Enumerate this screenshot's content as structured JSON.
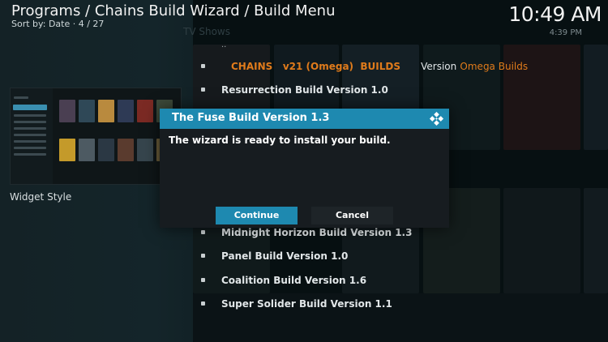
{
  "header": {
    "breadcrumb": "Programs / Chains Build Wizard / Build Menu",
    "sort_info": "Sort by: Date  ·  4 / 27",
    "clock": "10:49 AM",
    "clock_sub": "4:39 PM"
  },
  "background": {
    "faint_label": "TV Shows"
  },
  "widget": {
    "label": "Widget Style"
  },
  "menu": {
    "parent": "..",
    "top_row": {
      "chains": "CHAINS",
      "kodi_version": "v21 (Omega)",
      "builds": "BUILDS",
      "version_label": "Version",
      "version_value": "Omega Builds"
    },
    "items": [
      "Resurrection Build Version 1.0",
      "Midnight Horizon Build Version 1.3",
      "Panel Build Version 1.0",
      "Coalition Build Version 1.6",
      "Super Solider Build Version 1.1"
    ]
  },
  "dialog": {
    "title": "The Fuse Build Version 1.3",
    "message": "The wizard is ready to install your build.",
    "continue_label": "Continue",
    "cancel_label": "Cancel"
  },
  "colors": {
    "accent": "#1e89b0",
    "orange": "#e07b1b",
    "dialog_bg": "#171c20"
  },
  "icons": {
    "dialog_logo": "kodi-logo-icon"
  }
}
